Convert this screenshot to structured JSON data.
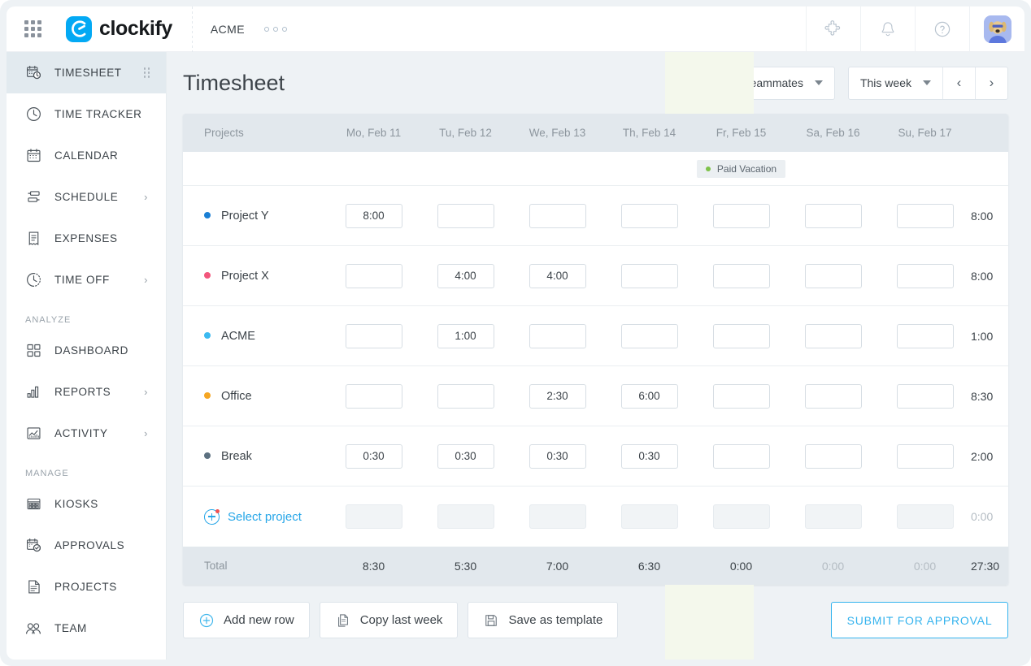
{
  "topbar": {
    "apps_icon": "grid-apps-icon",
    "logo_icon": "clockify-logo-icon",
    "brand": "clockify",
    "workspace": "ACME",
    "more_icon": "more-dots-icon",
    "integrations_icon": "puzzle-piece-icon",
    "notifications_icon": "bell-icon",
    "help_icon": "question-mark-icon",
    "avatar_icon": "user-avatar"
  },
  "sidebar": {
    "items": [
      {
        "label": "TIMESHEET",
        "icon": "calendar-clock-icon",
        "active": true,
        "chevron": false,
        "drag": true
      },
      {
        "label": "TIME TRACKER",
        "icon": "clock-icon",
        "active": false,
        "chevron": false,
        "drag": false
      },
      {
        "label": "CALENDAR",
        "icon": "calendar-icon",
        "active": false,
        "chevron": false,
        "drag": false
      },
      {
        "label": "SCHEDULE",
        "icon": "schedule-bars-icon",
        "active": false,
        "chevron": true,
        "drag": false
      },
      {
        "label": "EXPENSES",
        "icon": "receipt-icon",
        "active": false,
        "chevron": false,
        "drag": false
      },
      {
        "label": "TIME OFF",
        "icon": "dotted-clock-icon",
        "active": false,
        "chevron": true,
        "drag": false
      }
    ],
    "section_analyze": "ANALYZE",
    "analyze_items": [
      {
        "label": "DASHBOARD",
        "icon": "dashboard-grid-icon",
        "chevron": false
      },
      {
        "label": "REPORTS",
        "icon": "bar-chart-icon",
        "chevron": true
      },
      {
        "label": "ACTIVITY",
        "icon": "activity-chart-icon",
        "chevron": true
      }
    ],
    "section_manage": "MANAGE",
    "manage_items": [
      {
        "label": "KIOSKS",
        "icon": "kiosk-grid-icon",
        "chevron": false
      },
      {
        "label": "APPROVALS",
        "icon": "calendar-check-icon",
        "chevron": false
      },
      {
        "label": "PROJECTS",
        "icon": "document-lines-icon",
        "chevron": false
      },
      {
        "label": "TEAM",
        "icon": "people-icon",
        "chevron": false
      }
    ]
  },
  "page": {
    "title": "Timesheet",
    "teammates_filter": "Teammates",
    "week_filter": "This week",
    "prev_icon": "chevron-left-icon",
    "next_icon": "chevron-right-icon"
  },
  "timesheet": {
    "projects_header": "Projects",
    "days": [
      "Mo, Feb 11",
      "Tu, Feb 12",
      "We, Feb 13",
      "Th, Feb 14",
      "Fr, Feb 15",
      "Sa, Feb 16",
      "Su, Feb 17"
    ],
    "vacation_badge": {
      "label": "Paid Vacation",
      "day_index": 4,
      "dot_color": "#7ec24a"
    },
    "highlight_day_index": 4,
    "highlight_color": "#f4f8ec",
    "rows": [
      {
        "project": "Project Y",
        "color": "#1a7fd4",
        "values": [
          "8:00",
          "",
          "",
          "",
          "",
          "",
          ""
        ],
        "total": "8:00"
      },
      {
        "project": "Project X",
        "color": "#f2567c",
        "values": [
          "",
          "4:00",
          "4:00",
          "",
          "",
          "",
          ""
        ],
        "total": "8:00"
      },
      {
        "project": "ACME",
        "color": "#3bb9f0",
        "values": [
          "",
          "1:00",
          "",
          "",
          "",
          "",
          ""
        ],
        "total": "1:00"
      },
      {
        "project": "Office",
        "color": "#f5a623",
        "values": [
          "",
          "",
          "2:30",
          "6:00",
          "",
          "",
          ""
        ],
        "total": "8:30"
      },
      {
        "project": "Break",
        "color": "#5c7080",
        "values": [
          "0:30",
          "0:30",
          "0:30",
          "0:30",
          "",
          "",
          ""
        ],
        "total": "2:00"
      }
    ],
    "select_project": {
      "label": "Select project",
      "icon": "plus-circle-icon",
      "total": "0:00"
    },
    "total_label": "Total",
    "totals": [
      "8:30",
      "5:30",
      "7:00",
      "6:30",
      "0:00",
      "0:00",
      "0:00"
    ],
    "totals_muted": [
      false,
      false,
      false,
      false,
      false,
      true,
      true
    ],
    "grand_total": "27:30"
  },
  "footer": {
    "add_new_row": {
      "label": "Add new row",
      "icon": "plus-circle-icon"
    },
    "copy_last_week": {
      "label": "Copy last week",
      "icon": "copy-document-icon"
    },
    "save_as_template": {
      "label": "Save as template",
      "icon": "floppy-disk-icon"
    },
    "submit": "SUBMIT FOR APPROVAL"
  }
}
